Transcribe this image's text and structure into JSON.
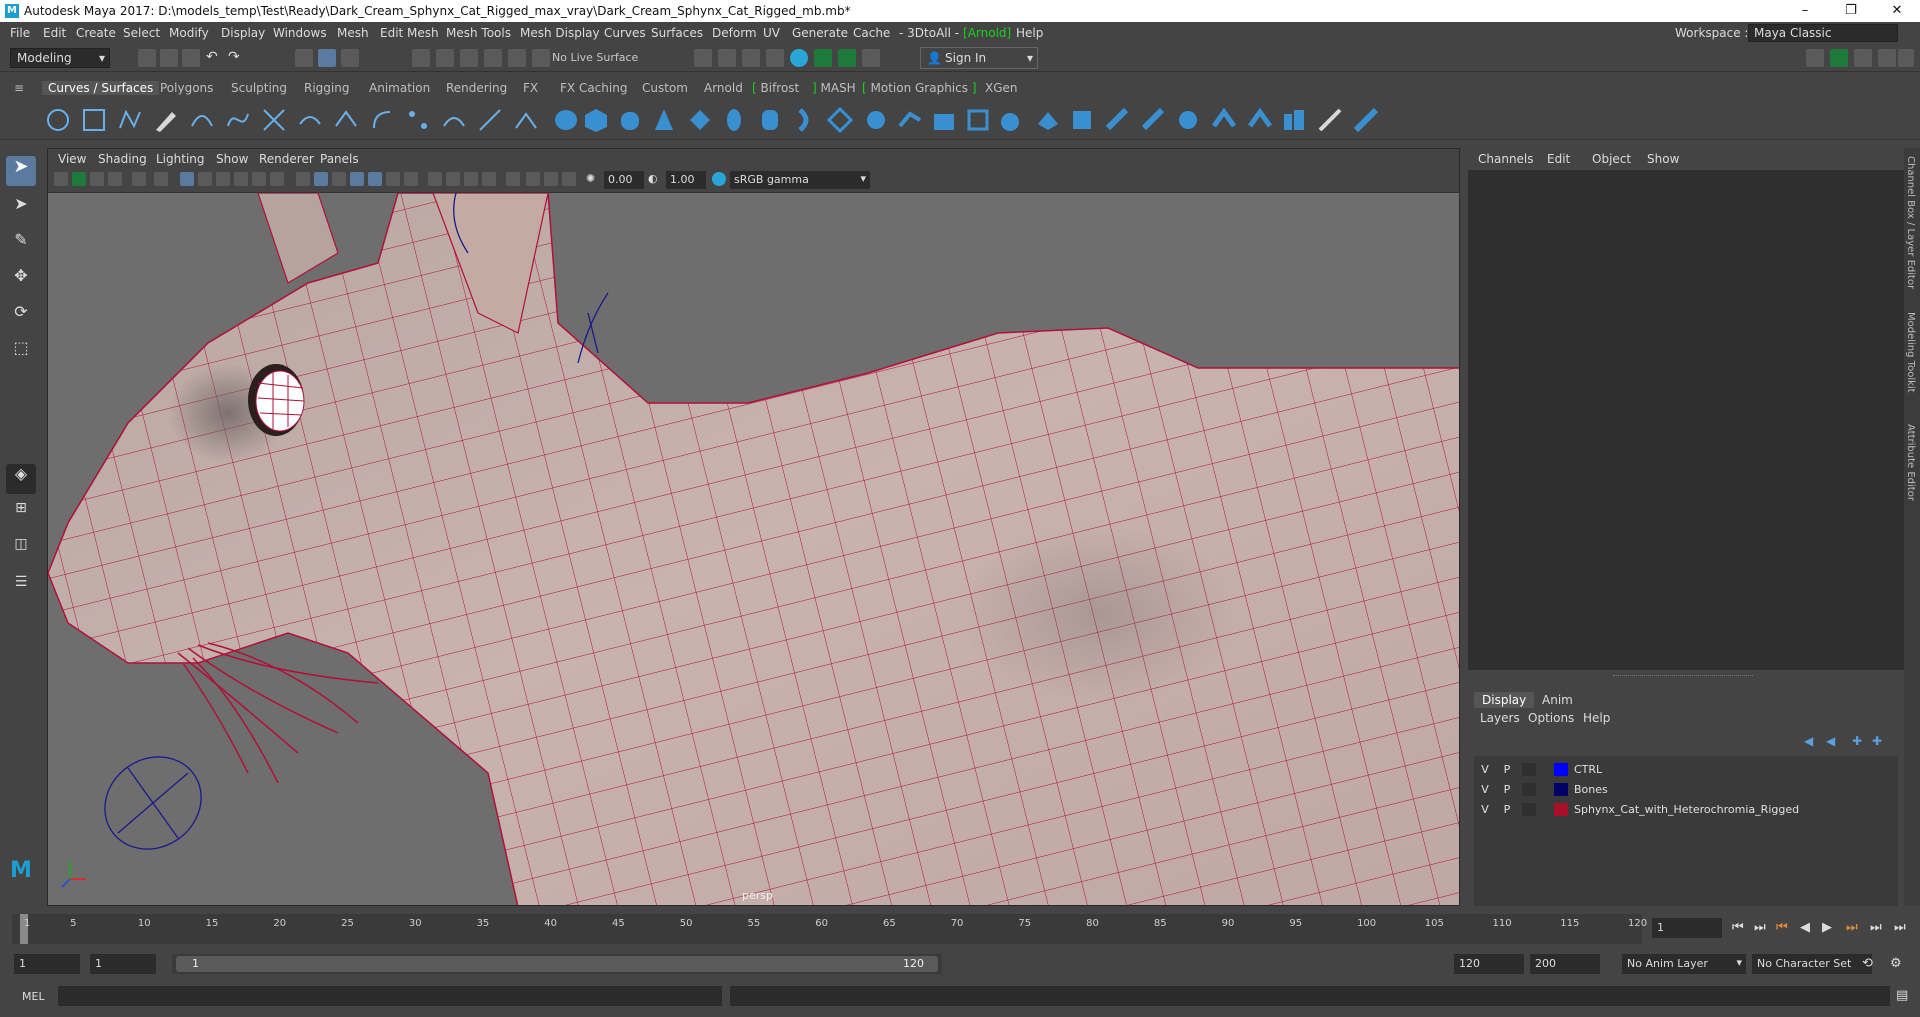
{
  "titlebar": {
    "title": "Autodesk Maya 2017: D:\\models_temp\\Test\\Ready\\Dark_Cream_Sphynx_Cat_Rigged_max_vray\\Dark_Cream_Sphynx_Cat_Rigged_mb.mb*",
    "app_icon": "M",
    "minimize": "–",
    "restore": "❐",
    "close": "✕"
  },
  "menubar": {
    "items": [
      "File",
      "Edit",
      "Create",
      "Select",
      "Modify",
      "Display",
      "Windows",
      "Mesh",
      "Edit Mesh",
      "Mesh Tools",
      "Mesh Display",
      "Curves",
      "Surfaces",
      "Deform",
      "UV",
      "Generate",
      "Cache",
      "- 3DtoAll -",
      "Arnold",
      "Help"
    ],
    "workspace_label": "Workspace :",
    "workspace_value": "Maya Classic"
  },
  "statusline": {
    "mode": "Modeling",
    "live_surface": "No Live Surface",
    "sign_in": "Sign In"
  },
  "shelf_tabs": [
    "Curves / Surfaces",
    "Polygons",
    "Sculpting",
    "Rigging",
    "Animation",
    "Rendering",
    "FX",
    "FX Caching",
    "Custom",
    "Arnold",
    "Bifrost",
    "MASH",
    "Motion Graphics",
    "XGen"
  ],
  "viewport": {
    "menu": [
      "View",
      "Shading",
      "Lighting",
      "Show",
      "Renderer",
      "Panels"
    ],
    "exposure": "0.00",
    "gamma": "1.00",
    "color_space": "sRGB gamma",
    "camera": "persp"
  },
  "channelbox": {
    "menu": [
      "Channels",
      "Edit",
      "Object",
      "Show"
    ]
  },
  "layers": {
    "tabs": [
      "Display",
      "Anim"
    ],
    "menu": [
      "Layers",
      "Options",
      "Help"
    ],
    "rows": [
      {
        "v": "V",
        "p": "P",
        "color": "#0000ff",
        "name": "CTRL"
      },
      {
        "v": "V",
        "p": "P",
        "color": "#000066",
        "name": "Bones"
      },
      {
        "v": "V",
        "p": "P",
        "color": "#a8102a",
        "name": "Sphynx_Cat_with_Heterochromia_Rigged"
      }
    ]
  },
  "side_tabs": [
    "Channel Box / Layer Editor",
    "Modeling Toolkit",
    "Attribute Editor"
  ],
  "timeline": {
    "ticks": [
      "1",
      "5",
      "10",
      "15",
      "20",
      "25",
      "30",
      "35",
      "40",
      "45",
      "50",
      "55",
      "60",
      "65",
      "70",
      "75",
      "80",
      "85",
      "90",
      "95",
      "100",
      "105",
      "110",
      "115",
      "120"
    ],
    "current_frame": "1"
  },
  "rangebar": {
    "start": "1",
    "inner_start": "1",
    "slider_start": "1",
    "slider_end": "120",
    "inner_end": "120",
    "end": "200",
    "anim_layer": "No Anim Layer",
    "character_set": "No Character Set"
  },
  "cmdline": {
    "label": "MEL"
  },
  "colors": {
    "ui_bg": "#444444",
    "viewport_bg": "#6e6e6e",
    "wire": "#b0103a",
    "arnold_bracket": "#19d019"
  }
}
